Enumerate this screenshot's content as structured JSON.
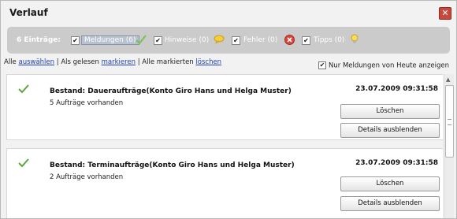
{
  "window": {
    "title": "Verlauf",
    "close_label": "✕"
  },
  "filter": {
    "count_label": "6 Einträge:",
    "items": [
      {
        "label": "Meldungen (6)",
        "checked": true,
        "icon": "check-icon"
      },
      {
        "label": "Hinweise (0)",
        "checked": true,
        "icon": "speech-bubble-icon"
      },
      {
        "label": "Fehler (0)",
        "checked": true,
        "icon": "error-icon"
      },
      {
        "label": "Tipps (0)",
        "checked": true,
        "icon": "lightbulb-icon"
      }
    ],
    "check_mark": "✔"
  },
  "actions": {
    "all_prefix": "Alle ",
    "select_link": "auswählen",
    "sep1": " | Als gelesen ",
    "mark_link": "markieren",
    "sep2": " | Alle markierten ",
    "delete_link": "löschen"
  },
  "today_toggle": {
    "label": "Nur Meldungen von Heute anzeigen",
    "checked": true,
    "mark": "✔"
  },
  "messages": [
    {
      "title": "Bestand: Daueraufträge(Konto Giro Hans und Helga Muster)",
      "subtitle": "5 Aufträge vorhanden",
      "date": "23.07.2009 09:31:58",
      "delete_label": "Löschen",
      "details_label": "Details ausblenden"
    },
    {
      "title": "Bestand: Terminaufträge(Konto Giro Hans und Helga Muster)",
      "subtitle": "2 Aufträge vorhanden",
      "date": "23.07.2009 09:31:58",
      "delete_label": "Löschen",
      "details_label": "Details ausblenden"
    }
  ],
  "colors": {
    "accent_link": "#1f3fbf",
    "filter_bg": "#cbcbcb",
    "close_red": "#c9473b",
    "check_green": "#5aa83a"
  }
}
